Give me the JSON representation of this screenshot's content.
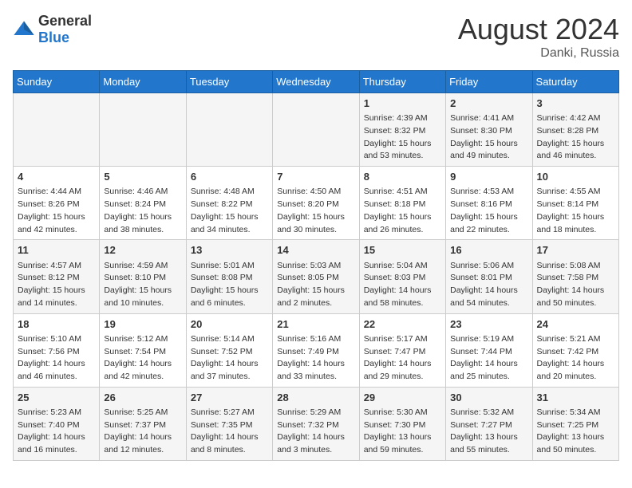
{
  "header": {
    "logo_general": "General",
    "logo_blue": "Blue",
    "month_title": "August 2024",
    "location": "Danki, Russia"
  },
  "calendar": {
    "days_of_week": [
      "Sunday",
      "Monday",
      "Tuesday",
      "Wednesday",
      "Thursday",
      "Friday",
      "Saturday"
    ],
    "weeks": [
      [
        {
          "day": "",
          "info": ""
        },
        {
          "day": "",
          "info": ""
        },
        {
          "day": "",
          "info": ""
        },
        {
          "day": "",
          "info": ""
        },
        {
          "day": "1",
          "info": "Sunrise: 4:39 AM\nSunset: 8:32 PM\nDaylight: 15 hours\nand 53 minutes."
        },
        {
          "day": "2",
          "info": "Sunrise: 4:41 AM\nSunset: 8:30 PM\nDaylight: 15 hours\nand 49 minutes."
        },
        {
          "day": "3",
          "info": "Sunrise: 4:42 AM\nSunset: 8:28 PM\nDaylight: 15 hours\nand 46 minutes."
        }
      ],
      [
        {
          "day": "4",
          "info": "Sunrise: 4:44 AM\nSunset: 8:26 PM\nDaylight: 15 hours\nand 42 minutes."
        },
        {
          "day": "5",
          "info": "Sunrise: 4:46 AM\nSunset: 8:24 PM\nDaylight: 15 hours\nand 38 minutes."
        },
        {
          "day": "6",
          "info": "Sunrise: 4:48 AM\nSunset: 8:22 PM\nDaylight: 15 hours\nand 34 minutes."
        },
        {
          "day": "7",
          "info": "Sunrise: 4:50 AM\nSunset: 8:20 PM\nDaylight: 15 hours\nand 30 minutes."
        },
        {
          "day": "8",
          "info": "Sunrise: 4:51 AM\nSunset: 8:18 PM\nDaylight: 15 hours\nand 26 minutes."
        },
        {
          "day": "9",
          "info": "Sunrise: 4:53 AM\nSunset: 8:16 PM\nDaylight: 15 hours\nand 22 minutes."
        },
        {
          "day": "10",
          "info": "Sunrise: 4:55 AM\nSunset: 8:14 PM\nDaylight: 15 hours\nand 18 minutes."
        }
      ],
      [
        {
          "day": "11",
          "info": "Sunrise: 4:57 AM\nSunset: 8:12 PM\nDaylight: 15 hours\nand 14 minutes."
        },
        {
          "day": "12",
          "info": "Sunrise: 4:59 AM\nSunset: 8:10 PM\nDaylight: 15 hours\nand 10 minutes."
        },
        {
          "day": "13",
          "info": "Sunrise: 5:01 AM\nSunset: 8:08 PM\nDaylight: 15 hours\nand 6 minutes."
        },
        {
          "day": "14",
          "info": "Sunrise: 5:03 AM\nSunset: 8:05 PM\nDaylight: 15 hours\nand 2 minutes."
        },
        {
          "day": "15",
          "info": "Sunrise: 5:04 AM\nSunset: 8:03 PM\nDaylight: 14 hours\nand 58 minutes."
        },
        {
          "day": "16",
          "info": "Sunrise: 5:06 AM\nSunset: 8:01 PM\nDaylight: 14 hours\nand 54 minutes."
        },
        {
          "day": "17",
          "info": "Sunrise: 5:08 AM\nSunset: 7:58 PM\nDaylight: 14 hours\nand 50 minutes."
        }
      ],
      [
        {
          "day": "18",
          "info": "Sunrise: 5:10 AM\nSunset: 7:56 PM\nDaylight: 14 hours\nand 46 minutes."
        },
        {
          "day": "19",
          "info": "Sunrise: 5:12 AM\nSunset: 7:54 PM\nDaylight: 14 hours\nand 42 minutes."
        },
        {
          "day": "20",
          "info": "Sunrise: 5:14 AM\nSunset: 7:52 PM\nDaylight: 14 hours\nand 37 minutes."
        },
        {
          "day": "21",
          "info": "Sunrise: 5:16 AM\nSunset: 7:49 PM\nDaylight: 14 hours\nand 33 minutes."
        },
        {
          "day": "22",
          "info": "Sunrise: 5:17 AM\nSunset: 7:47 PM\nDaylight: 14 hours\nand 29 minutes."
        },
        {
          "day": "23",
          "info": "Sunrise: 5:19 AM\nSunset: 7:44 PM\nDaylight: 14 hours\nand 25 minutes."
        },
        {
          "day": "24",
          "info": "Sunrise: 5:21 AM\nSunset: 7:42 PM\nDaylight: 14 hours\nand 20 minutes."
        }
      ],
      [
        {
          "day": "25",
          "info": "Sunrise: 5:23 AM\nSunset: 7:40 PM\nDaylight: 14 hours\nand 16 minutes."
        },
        {
          "day": "26",
          "info": "Sunrise: 5:25 AM\nSunset: 7:37 PM\nDaylight: 14 hours\nand 12 minutes."
        },
        {
          "day": "27",
          "info": "Sunrise: 5:27 AM\nSunset: 7:35 PM\nDaylight: 14 hours\nand 8 minutes."
        },
        {
          "day": "28",
          "info": "Sunrise: 5:29 AM\nSunset: 7:32 PM\nDaylight: 14 hours\nand 3 minutes."
        },
        {
          "day": "29",
          "info": "Sunrise: 5:30 AM\nSunset: 7:30 PM\nDaylight: 13 hours\nand 59 minutes."
        },
        {
          "day": "30",
          "info": "Sunrise: 5:32 AM\nSunset: 7:27 PM\nDaylight: 13 hours\nand 55 minutes."
        },
        {
          "day": "31",
          "info": "Sunrise: 5:34 AM\nSunset: 7:25 PM\nDaylight: 13 hours\nand 50 minutes."
        }
      ]
    ]
  }
}
